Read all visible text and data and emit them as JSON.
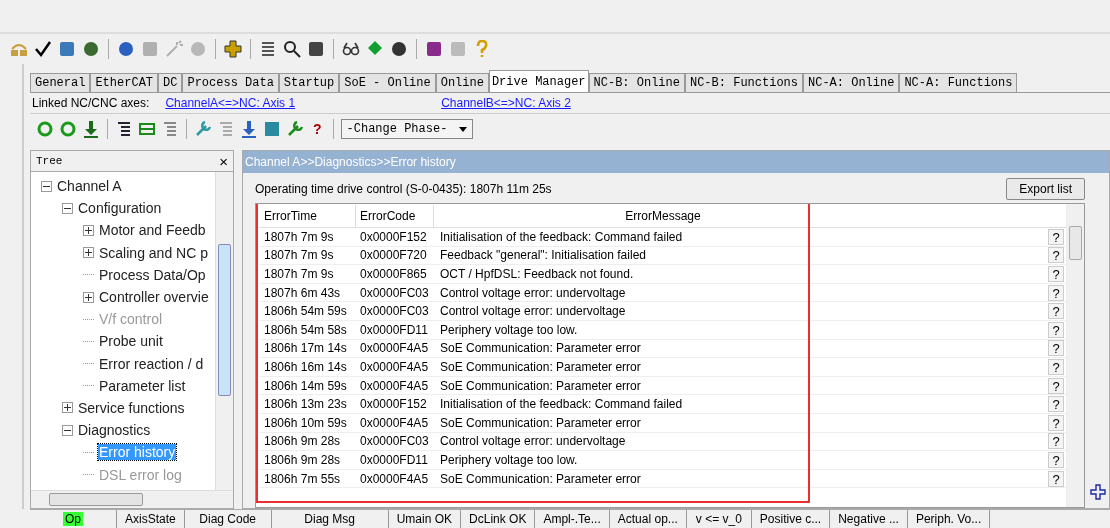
{
  "tabs": [
    {
      "label": "General",
      "selected": false
    },
    {
      "label": "EtherCAT",
      "selected": false
    },
    {
      "label": "DC",
      "selected": false
    },
    {
      "label": "Process Data",
      "selected": false
    },
    {
      "label": "Startup",
      "selected": false
    },
    {
      "label": "SoE - Online",
      "selected": false
    },
    {
      "label": "Online",
      "selected": false
    },
    {
      "label": "Drive Manager",
      "selected": true
    },
    {
      "label": "NC-B: Online",
      "selected": false
    },
    {
      "label": "NC-B: Functions",
      "selected": false
    },
    {
      "label": "NC-A: Online",
      "selected": false
    },
    {
      "label": "NC-A: Functions",
      "selected": false
    }
  ],
  "linked_axes": {
    "label": "Linked NC/CNC axes:",
    "links": [
      "ChannelA<=>NC: Axis 1",
      "ChannelB<=>NC: Axis 2"
    ]
  },
  "toolbar": {
    "help": "?",
    "phase_dropdown": "-Change Phase-"
  },
  "tree": {
    "title": "Tree",
    "close": "×",
    "items": [
      {
        "label": "Channel A",
        "expanded": true,
        "disabled": false,
        "selected": false,
        "children": [
          {
            "label": "Configuration",
            "expanded": true,
            "disabled": false,
            "selected": false,
            "children": [
              {
                "label": "Motor and Feedb",
                "expanded": false,
                "disabled": false,
                "selected": false
              },
              {
                "label": "Scaling and NC p",
                "expanded": false,
                "disabled": false,
                "selected": false
              },
              {
                "label": "Process Data/Op",
                "disabled": false,
                "selected": false
              },
              {
                "label": "Controller overvie",
                "expanded": false,
                "disabled": false,
                "selected": false
              },
              {
                "label": "V/f control",
                "disabled": true,
                "selected": false
              },
              {
                "label": "Probe unit",
                "disabled": false,
                "selected": false
              },
              {
                "label": "Error reaction / d",
                "disabled": false,
                "selected": false
              },
              {
                "label": "Parameter list",
                "disabled": false,
                "selected": false
              }
            ]
          },
          {
            "label": "Service functions",
            "expanded": false,
            "disabled": false,
            "selected": false
          },
          {
            "label": "Diagnostics",
            "expanded": true,
            "disabled": false,
            "selected": false,
            "children": [
              {
                "label": "Error history",
                "disabled": false,
                "selected": true
              },
              {
                "label": "DSL error log",
                "disabled": true,
                "selected": false
              }
            ]
          }
        ]
      }
    ]
  },
  "panel": {
    "breadcrumb": "Channel A>>Diagnostics>>Error history",
    "operating_time": "Operating time drive control (S-0-0435): 1807h 11m 25s",
    "export_button": "Export list"
  },
  "table": {
    "columns": [
      "ErrorTime",
      "ErrorCode",
      "ErrorMessage"
    ],
    "rows": [
      {
        "time": "1807h 7m 9s",
        "code": "0x0000F152",
        "message": "Initialisation of the feedback: Command failed",
        "help": "?"
      },
      {
        "time": "1807h 7m 9s",
        "code": "0x0000F720",
        "message": "Feedback \"general\": Initialisation failed",
        "help": "?"
      },
      {
        "time": "1807h 7m 9s",
        "code": "0x0000F865",
        "message": "OCT / HpfDSL: Feedback not found.",
        "help": "?"
      },
      {
        "time": "1807h 6m 43s",
        "code": "0x0000FC03",
        "message": "Control voltage error: undervoltage",
        "help": "?"
      },
      {
        "time": "1806h 54m 59s",
        "code": "0x0000FC03",
        "message": "Control voltage error: undervoltage",
        "help": "?"
      },
      {
        "time": "1806h 54m 58s",
        "code": "0x0000FD11",
        "message": "Periphery voltage too low.",
        "help": "?"
      },
      {
        "time": "1806h 17m 14s",
        "code": "0x0000F4A5",
        "message": "SoE Communication: Parameter error",
        "help": "?"
      },
      {
        "time": "1806h 16m 14s",
        "code": "0x0000F4A5",
        "message": "SoE Communication: Parameter error",
        "help": "?"
      },
      {
        "time": "1806h 14m 59s",
        "code": "0x0000F4A5",
        "message": "SoE Communication: Parameter error",
        "help": "?"
      },
      {
        "time": "1806h 13m 23s",
        "code": "0x0000F152",
        "message": "Initialisation of the feedback: Command failed",
        "help": "?"
      },
      {
        "time": "1806h 10m 59s",
        "code": "0x0000F4A5",
        "message": "SoE Communication: Parameter error",
        "help": "?"
      },
      {
        "time": "1806h 9m 28s",
        "code": "0x0000FC03",
        "message": "Control voltage error: undervoltage",
        "help": "?"
      },
      {
        "time": "1806h 9m 28s",
        "code": "0x0000FD11",
        "message": "Periphery voltage too low.",
        "help": "?"
      },
      {
        "time": "1806h 7m 55s",
        "code": "0x0000F4A5",
        "message": "SoE Communication: Parameter error",
        "help": "?"
      }
    ]
  },
  "status_bar": [
    {
      "label": "Op",
      "on": true
    },
    {
      "label": "AxisState",
      "on": false
    },
    {
      "label": "Diag Code",
      "on": false
    },
    {
      "label": "Diag Msg",
      "on": false
    },
    {
      "label": "Umain OK",
      "on": false
    },
    {
      "label": "DcLink OK",
      "on": false
    },
    {
      "label": "Ampl-.Te...",
      "on": false
    },
    {
      "label": "Actual op...",
      "on": false
    },
    {
      "label": "v <= v_0",
      "on": false
    },
    {
      "label": "Positive c...",
      "on": false
    },
    {
      "label": "Negative ...",
      "on": false
    },
    {
      "label": "Periph. Vo...",
      "on": false
    }
  ]
}
